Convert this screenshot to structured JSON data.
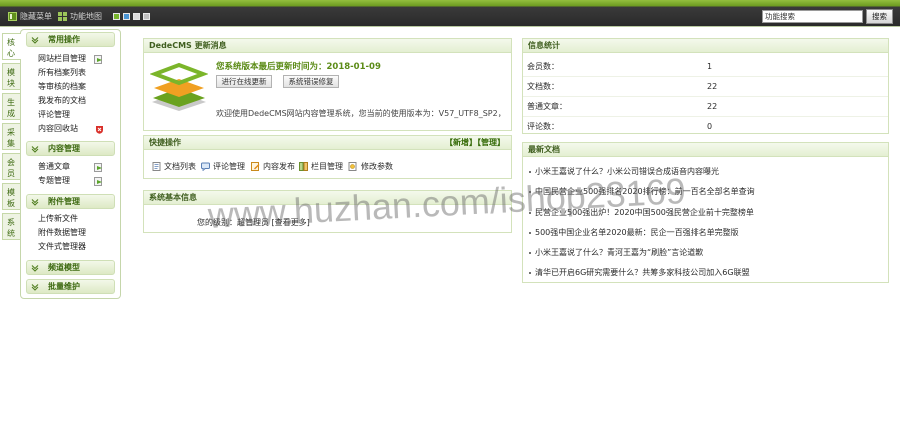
{
  "topbar": {
    "hide_menu": "隐藏菜单",
    "function_map": "功能地图",
    "skin_colors": [
      "#78b52e",
      "#4a95d3",
      "#dcdcdc",
      "#bfbfbf"
    ],
    "search_value": "功能搜索",
    "search_button": "搜索"
  },
  "side_tabs": [
    {
      "label": "核心",
      "active": true
    },
    {
      "label": "模块",
      "active": false
    },
    {
      "label": "生成",
      "active": false
    },
    {
      "label": "采集",
      "active": false
    },
    {
      "label": "会员",
      "active": false
    },
    {
      "label": "模板",
      "active": false
    },
    {
      "label": "系统",
      "active": false
    }
  ],
  "menu": {
    "sections": [
      {
        "title": "常用操作",
        "items": [
          {
            "label": "网站栏目管理",
            "icon": "add-icon"
          },
          {
            "label": "所有档案列表"
          },
          {
            "label": "等审核的档案"
          },
          {
            "label": "我发布的文档"
          },
          {
            "label": "评论管理"
          },
          {
            "label": "内容回收站",
            "icon": "recycle-icon"
          }
        ]
      },
      {
        "title": "内容管理",
        "items": [
          {
            "label": "普通文章",
            "icon": "add-icon"
          },
          {
            "label": "专题管理",
            "icon": "add-icon"
          }
        ]
      },
      {
        "title": "附件管理",
        "items": [
          {
            "label": "上传新文件"
          },
          {
            "label": "附件数据管理"
          },
          {
            "label": "文件式管理器"
          }
        ]
      },
      {
        "title": "频道模型",
        "items": []
      },
      {
        "title": "批量维护",
        "items": []
      }
    ]
  },
  "update_panel": {
    "title": "DedeCMS 更新消息",
    "version_text": "您系统版本最后更新时间为：2018-01-09",
    "buttons": [
      "进行在线更新",
      "系统错误修复"
    ],
    "welcome": "欢迎使用DedeCMS网站内容管理系统，您当前的使用版本为：V57_UTF8_SP2，"
  },
  "quick_panel": {
    "title": "快捷操作",
    "header_links": [
      "【新增】",
      "【管理】"
    ],
    "items": [
      {
        "label": "文档列表",
        "icon": "document-list-icon"
      },
      {
        "label": "评论管理",
        "icon": "comment-icon"
      },
      {
        "label": "内容发布",
        "icon": "publish-icon"
      },
      {
        "label": "栏目管理",
        "icon": "column-icon"
      },
      {
        "label": "修改参数",
        "icon": "settings-doc-icon"
      }
    ]
  },
  "sysinfo_panel": {
    "title": "系统基本信息",
    "level_text": "您的级别：超管理员",
    "more_link": "[查看更多]"
  },
  "stats_panel": {
    "title": "信息统计",
    "rows": [
      {
        "label": "会员数：",
        "value": "1"
      },
      {
        "label": "文档数：",
        "value": "22"
      },
      {
        "label": "普通文章：",
        "value": "22"
      },
      {
        "label": "评论数：",
        "value": "0"
      }
    ]
  },
  "latest_panel": {
    "title": "最新文档",
    "items": [
      "小米王嘉说了什么？小米公司错误合成语音内容曝光",
      "中国民营企业500强排名2020排行榜：前一百名全部名单查询",
      "民营企业500强出炉！2020中国500强民营企业前十完整榜单",
      "500强中国企业名单2020最新：民企一百强排名单完整版",
      "小米王嘉说了什么？青河王嘉为“刷脸”言论道歉",
      "清华已开启6G研究需要什么？共筹多家科技公司加入6G联盟"
    ]
  },
  "watermark": "www.huzhan.com/ishop23169",
  "colors": {
    "accent": "#3d6a11",
    "version_text": "#5b8b16",
    "topbar": "#2a2a2a",
    "panel_header": "#e4efd2",
    "panel_border": "#d3e2bb"
  }
}
